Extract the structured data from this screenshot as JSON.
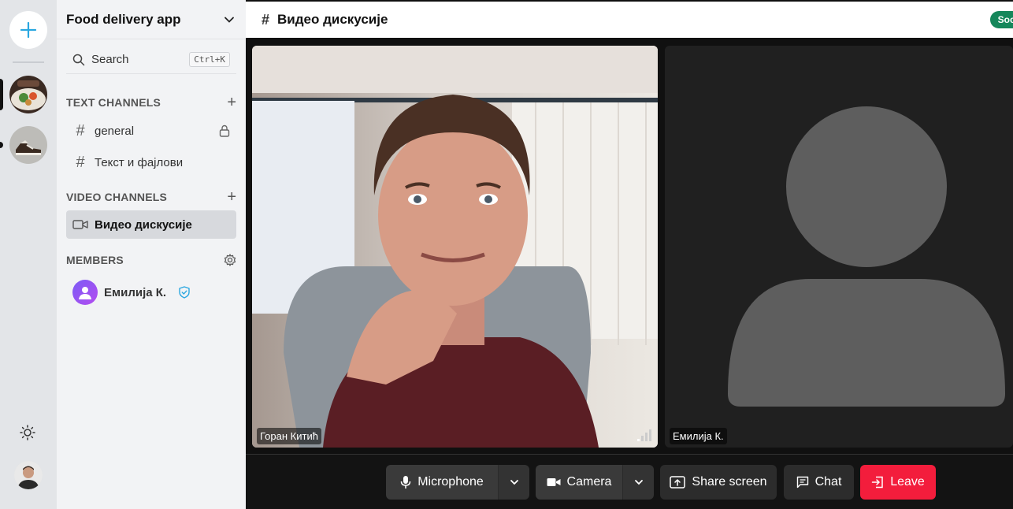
{
  "rail": {
    "add_icon": "plus-icon",
    "servers": [
      {
        "name": "food-server",
        "active": true
      },
      {
        "name": "sneaker-server",
        "active": false
      }
    ],
    "theme_icon": "sun-icon"
  },
  "sidebar": {
    "server_name": "Food delivery app",
    "search": {
      "label": "Search",
      "shortcut": "Ctrl+K"
    },
    "text_channels": {
      "title": "TEXT CHANNELS",
      "items": [
        {
          "label": "general",
          "locked": true
        },
        {
          "label": "Текст и фајлови",
          "locked": false
        }
      ]
    },
    "video_channels": {
      "title": "VIDEO CHANNELS",
      "items": [
        {
          "label": "Видео дискусије",
          "active": true
        }
      ]
    },
    "members": {
      "title": "MEMBERS",
      "items": [
        {
          "name": "Емилија К.",
          "verified": true
        }
      ]
    }
  },
  "main": {
    "channel_title": "Видео дискусије",
    "status_badge": "Socket c",
    "participants": [
      {
        "name": "Горан Китић",
        "video": true
      },
      {
        "name": "Емилија К.",
        "video": false
      }
    ],
    "controls": {
      "microphone": "Microphone",
      "camera": "Camera",
      "share_screen": "Share screen",
      "chat": "Chat",
      "leave": "Leave"
    }
  },
  "colors": {
    "accent": "#2aa7e0",
    "leave": "#f31d3c",
    "badge": "#15875b"
  }
}
